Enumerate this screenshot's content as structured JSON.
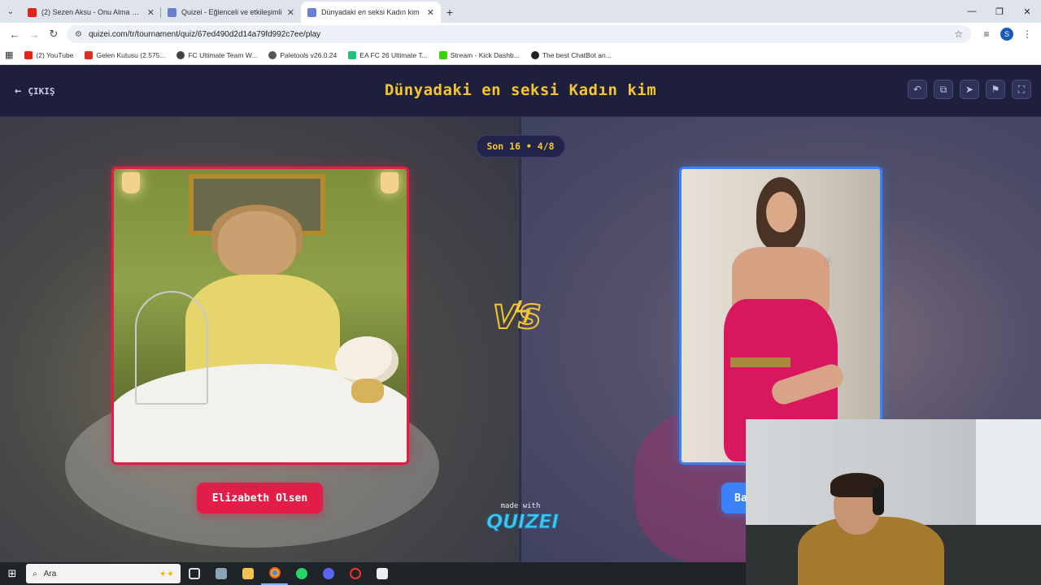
{
  "browser": {
    "tabs": [
      {
        "title": "(2) Sezen Aksu - Onu Alma Ben",
        "favicon_color": "#e62117",
        "active": false
      },
      {
        "title": "Quizei - Eğlenceli ve etkileşimli",
        "favicon_color": "#6a7fd0",
        "active": false
      },
      {
        "title": "Dünyadaki en seksi Kadın kim",
        "favicon_color": "#6a7fd0",
        "active": true
      }
    ],
    "url": "quizei.com/tr/tournament/quiz/67ed490d2d14a79fd992c7ee/play",
    "profile_initial": "S",
    "bookmarks": [
      {
        "label": "(2) YouTube",
        "color": "#e62117"
      },
      {
        "label": "Gelen Kutusu (2.575...",
        "color": "#d93025"
      },
      {
        "label": "FC Ultimate Team W...",
        "color": "#444444"
      },
      {
        "label": "Paletools v26.0.24",
        "color": "#555555"
      },
      {
        "label": "EA FC 26 Ultimate T...",
        "color": "#23c07a"
      },
      {
        "label": "Stream - Kick Dashb...",
        "color": "#3ad10b"
      },
      {
        "label": "The best ChatBot an...",
        "color": "#222222"
      }
    ]
  },
  "app": {
    "exit_label": "ÇIKIŞ",
    "title": "Dünyadaki en seksi Kadın kim",
    "round_label": "Son 16 • 4/8",
    "left_option": {
      "name": "Elizabeth Olsen",
      "color": "#e11d48"
    },
    "right_option": {
      "name": "Ba",
      "color": "#3b82f6"
    },
    "made_with": "made with",
    "brand": "QUIZEI",
    "accent": "#f4c531"
  },
  "taskbar": {
    "search_placeholder": "Ara"
  }
}
